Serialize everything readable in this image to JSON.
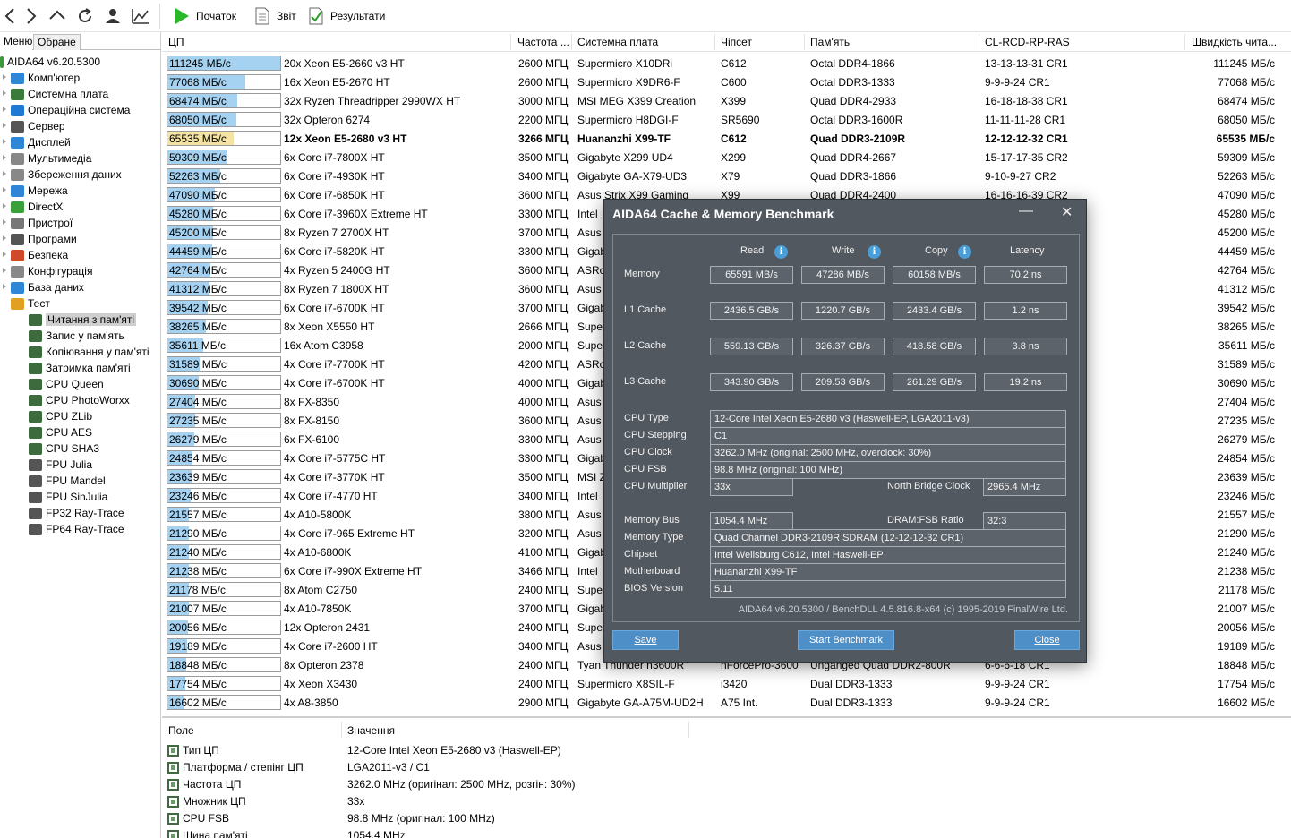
{
  "toolbar": {
    "start_label": "Початок",
    "report_label": "Звіт",
    "results_label": "Результати"
  },
  "left_panel": {
    "tab_menu": "Меню",
    "tab_favorites": "Обране",
    "tree": [
      {
        "label": "AIDA64 v6.20.5300",
        "icon": "aida64-icon",
        "color": "#3a9a3a"
      },
      {
        "label": "Комп'ютер",
        "icon": "computer-icon",
        "color": "#2f86d6"
      },
      {
        "label": "Системна плата",
        "icon": "motherboard-icon",
        "color": "#3a7a3a"
      },
      {
        "label": "Операційна система",
        "icon": "windows-icon",
        "color": "#1e78d4"
      },
      {
        "label": "Сервер",
        "icon": "server-icon",
        "color": "#555555"
      },
      {
        "label": "Дисплей",
        "icon": "display-icon",
        "color": "#2f86d6"
      },
      {
        "label": "Мультимедіа",
        "icon": "multimedia-icon",
        "color": "#888888"
      },
      {
        "label": "Збереження даних",
        "icon": "storage-icon",
        "color": "#888888"
      },
      {
        "label": "Мережа",
        "icon": "network-icon",
        "color": "#2f86d6"
      },
      {
        "label": "DirectX",
        "icon": "directx-icon",
        "color": "#3aa03a"
      },
      {
        "label": "Пристрої",
        "icon": "devices-icon",
        "color": "#777777"
      },
      {
        "label": "Програми",
        "icon": "programs-icon",
        "color": "#555555"
      },
      {
        "label": "Безпека",
        "icon": "security-icon",
        "color": "#d04a2a"
      },
      {
        "label": "Конфігурація",
        "icon": "config-icon",
        "color": "#888888"
      },
      {
        "label": "База даних",
        "icon": "database-icon",
        "color": "#2f86d6"
      },
      {
        "label": "Тест",
        "icon": "test-icon",
        "color": "#e0a020"
      },
      {
        "label": "Читання з пам'яті",
        "icon": "memory-read-icon",
        "color": "#3d6b3d"
      },
      {
        "label": "Запис у пам'ять",
        "icon": "memory-write-icon",
        "color": "#3d6b3d"
      },
      {
        "label": "Копіювання у пам'яті",
        "icon": "memory-copy-icon",
        "color": "#3d6b3d"
      },
      {
        "label": "Затримка пам'яті",
        "icon": "memory-latency-icon",
        "color": "#3d6b3d"
      },
      {
        "label": "CPU Queen",
        "icon": "cpu-queen-icon",
        "color": "#3d6b3d"
      },
      {
        "label": "CPU PhotoWorxx",
        "icon": "cpu-photoworxx-icon",
        "color": "#3d6b3d"
      },
      {
        "label": "CPU ZLib",
        "icon": "cpu-zlib-icon",
        "color": "#3d6b3d"
      },
      {
        "label": "CPU AES",
        "icon": "cpu-aes-icon",
        "color": "#3d6b3d"
      },
      {
        "label": "CPU SHA3",
        "icon": "cpu-sha3-icon",
        "color": "#3d6b3d"
      },
      {
        "label": "FPU Julia",
        "icon": "fpu-julia-icon",
        "color": "#555555"
      },
      {
        "label": "FPU Mandel",
        "icon": "fpu-mandel-icon",
        "color": "#555555"
      },
      {
        "label": "FPU SinJulia",
        "icon": "fpu-sinjulia-icon",
        "color": "#555555"
      },
      {
        "label": "FP32 Ray-Trace",
        "icon": "fp32-raytrace-icon",
        "color": "#555555"
      },
      {
        "label": "FP64 Ray-Trace",
        "icon": "fp64-raytrace-icon",
        "color": "#555555"
      }
    ]
  },
  "list": {
    "headers": [
      "ЦП",
      "Частота ...",
      "Системна плата",
      "Чіпсет",
      "Пам'ять",
      "CL-RCD-RP-RAS",
      "Швидкість чита..."
    ],
    "max_value": 111245,
    "rows": [
      {
        "bar": "111245 МБ/с",
        "value": 111245,
        "cpu": "20x Xeon E5-2660 v3 HT",
        "freq": "2600 МГЦ",
        "board": "Supermicro X10DRi",
        "chipset": "C612",
        "memory": "Octal DDR4-1866",
        "timings": "13-13-13-31 CR1",
        "speed": "111245 МБ/с"
      },
      {
        "bar": "77068 МБ/с",
        "value": 77068,
        "cpu": "16x Xeon E5-2670 HT",
        "freq": "2600 МГЦ",
        "board": "Supermicro X9DR6-F",
        "chipset": "C600",
        "memory": "Octal DDR3-1333",
        "timings": "9-9-9-24 CR1",
        "speed": "77068 МБ/с"
      },
      {
        "bar": "68474 МБ/с",
        "value": 68474,
        "cpu": "32x Ryzen Threadripper 2990WX HT",
        "freq": "3000 МГЦ",
        "board": "MSI MEG X399 Creation",
        "chipset": "X399",
        "memory": "Quad DDR4-2933",
        "timings": "16-18-18-38 CR1",
        "speed": "68474 МБ/с"
      },
      {
        "bar": "68050 МБ/с",
        "value": 68050,
        "cpu": "32x Opteron 6274",
        "freq": "2200 МГЦ",
        "board": "Supermicro H8DGI-F",
        "chipset": "SR5690",
        "memory": "Octal DDR3-1600R",
        "timings": "11-11-11-28 CR1",
        "speed": "68050 МБ/с"
      },
      {
        "bar": "65535 МБ/с",
        "value": 65535,
        "cpu": "12x Xeon E5-2680 v3 HT",
        "freq": "3266 МГЦ",
        "board": "Huananzhi X99-TF",
        "chipset": "C612",
        "memory": "Quad DDR3-2109R",
        "timings": "12-12-12-32 CR1",
        "speed": "65535 МБ/с",
        "highlight": true
      },
      {
        "bar": "59309 МБ/с",
        "value": 59309,
        "cpu": "6x Core i7-7800X HT",
        "freq": "3500 МГЦ",
        "board": "Gigabyte X299 UD4",
        "chipset": "X299",
        "memory": "Quad DDR4-2667",
        "timings": "15-17-17-35 CR2",
        "speed": "59309 МБ/с"
      },
      {
        "bar": "52263 МБ/с",
        "value": 52263,
        "cpu": "6x Core i7-4930K HT",
        "freq": "3400 МГЦ",
        "board": "Gigabyte GA-X79-UD3",
        "chipset": "X79",
        "memory": "Quad DDR3-1866",
        "timings": "9-10-9-27 CR2",
        "speed": "52263 МБ/с"
      },
      {
        "bar": "47090 МБ/с",
        "value": 47090,
        "cpu": "6x Core i7-6850K HT",
        "freq": "3600 МГЦ",
        "board": "Asus Strix X99 Gaming",
        "chipset": "X99",
        "memory": "Quad DDR4-2400",
        "timings": "16-16-16-39 CR2",
        "speed": "47090 МБ/с"
      },
      {
        "bar": "45280 МБ/с",
        "value": 45280,
        "cpu": "6x Core i7-3960X Extreme HT",
        "freq": "3300 МГЦ",
        "board": "Intel",
        "chipset": "",
        "memory": "",
        "timings": "",
        "speed": "45280 МБ/с"
      },
      {
        "bar": "45200 МБ/с",
        "value": 45200,
        "cpu": "8x Ryzen 7 2700X HT",
        "freq": "3700 МГЦ",
        "board": "Asus",
        "chipset": "",
        "memory": "",
        "timings": "",
        "speed": "45200 МБ/с"
      },
      {
        "bar": "44459 МБ/с",
        "value": 44459,
        "cpu": "6x Core i7-5820K HT",
        "freq": "3300 МГЦ",
        "board": "Gigab",
        "chipset": "",
        "memory": "",
        "timings": "",
        "speed": "44459 МБ/с"
      },
      {
        "bar": "42764 МБ/с",
        "value": 42764,
        "cpu": "4x Ryzen 5 2400G HT",
        "freq": "3600 МГЦ",
        "board": "ASRo",
        "chipset": "",
        "memory": "",
        "timings": "",
        "speed": "42764 МБ/с"
      },
      {
        "bar": "41312 МБ/с",
        "value": 41312,
        "cpu": "8x Ryzen 7 1800X HT",
        "freq": "3600 МГЦ",
        "board": "Asus",
        "chipset": "",
        "memory": "",
        "timings": "",
        "speed": "41312 МБ/с"
      },
      {
        "bar": "39542 МБ/с",
        "value": 39542,
        "cpu": "6x Core i7-6700K HT",
        "freq": "3700 МГЦ",
        "board": "Gigab",
        "chipset": "",
        "memory": "",
        "timings": "",
        "speed": "39542 МБ/с"
      },
      {
        "bar": "38265 МБ/с",
        "value": 38265,
        "cpu": "8x Xeon X5550 HT",
        "freq": "2666 МГЦ",
        "board": "Super",
        "chipset": "",
        "memory": "",
        "timings": "",
        "speed": "38265 МБ/с"
      },
      {
        "bar": "35611 МБ/с",
        "value": 35611,
        "cpu": "16x Atom C3958",
        "freq": "2000 МГЦ",
        "board": "Super",
        "chipset": "",
        "memory": "",
        "timings": "",
        "speed": "35611 МБ/с"
      },
      {
        "bar": "31589 МБ/с",
        "value": 31589,
        "cpu": "4x Core i7-7700K HT",
        "freq": "4200 МГЦ",
        "board": "ASRo",
        "chipset": "",
        "memory": "",
        "timings": "",
        "speed": "31589 МБ/с"
      },
      {
        "bar": "30690 МБ/с",
        "value": 30690,
        "cpu": "4x Core i7-6700K HT",
        "freq": "4000 МГЦ",
        "board": "Gigab",
        "chipset": "",
        "memory": "",
        "timings": "",
        "speed": "30690 МБ/с"
      },
      {
        "bar": "27404 МБ/с",
        "value": 27404,
        "cpu": "8x FX-8350",
        "freq": "4000 МГЦ",
        "board": "Asus",
        "chipset": "",
        "memory": "",
        "timings": "",
        "speed": "27404 МБ/с"
      },
      {
        "bar": "27235 МБ/с",
        "value": 27235,
        "cpu": "8x FX-8150",
        "freq": "3600 МГЦ",
        "board": "Asus",
        "chipset": "",
        "memory": "",
        "timings": "",
        "speed": "27235 МБ/с"
      },
      {
        "bar": "26279 МБ/с",
        "value": 26279,
        "cpu": "6x FX-6100",
        "freq": "3300 МГЦ",
        "board": "Asus",
        "chipset": "",
        "memory": "",
        "timings": "",
        "speed": "26279 МБ/с"
      },
      {
        "bar": "24854 МБ/с",
        "value": 24854,
        "cpu": "4x Core i7-5775C HT",
        "freq": "3300 МГЦ",
        "board": "Gigab",
        "chipset": "",
        "memory": "",
        "timings": "",
        "speed": "24854 МБ/с"
      },
      {
        "bar": "23639 МБ/с",
        "value": 23639,
        "cpu": "4x Core i7-3770K HT",
        "freq": "3500 МГЦ",
        "board": "MSI Z",
        "chipset": "",
        "memory": "",
        "timings": "",
        "speed": "23639 МБ/с"
      },
      {
        "bar": "23246 МБ/с",
        "value": 23246,
        "cpu": "4x Core i7-4770 HT",
        "freq": "3400 МГЦ",
        "board": "Intel",
        "chipset": "",
        "memory": "",
        "timings": "",
        "speed": "23246 МБ/с"
      },
      {
        "bar": "21557 МБ/с",
        "value": 21557,
        "cpu": "4x A10-5800K",
        "freq": "3800 МГЦ",
        "board": "Asus",
        "chipset": "",
        "memory": "",
        "timings": "",
        "speed": "21557 МБ/с"
      },
      {
        "bar": "21290 МБ/с",
        "value": 21290,
        "cpu": "4x Core i7-965 Extreme HT",
        "freq": "3200 МГЦ",
        "board": "Asus",
        "chipset": "",
        "memory": "",
        "timings": "",
        "speed": "21290 МБ/с"
      },
      {
        "bar": "21240 МБ/с",
        "value": 21240,
        "cpu": "4x A10-6800K",
        "freq": "4100 МГЦ",
        "board": "Gigab",
        "chipset": "",
        "memory": "",
        "timings": "",
        "speed": "21240 МБ/с"
      },
      {
        "bar": "21238 МБ/с",
        "value": 21238,
        "cpu": "6x Core i7-990X Extreme HT",
        "freq": "3466 МГЦ",
        "board": "Intel",
        "chipset": "",
        "memory": "",
        "timings": "",
        "speed": "21238 МБ/с"
      },
      {
        "bar": "21178 МБ/с",
        "value": 21178,
        "cpu": "8x Atom C2750",
        "freq": "2400 МГЦ",
        "board": "Super",
        "chipset": "",
        "memory": "",
        "timings": "",
        "speed": "21178 МБ/с"
      },
      {
        "bar": "21007 МБ/с",
        "value": 21007,
        "cpu": "4x A10-7850K",
        "freq": "3700 МГЦ",
        "board": "Gigab",
        "chipset": "",
        "memory": "",
        "timings": "",
        "speed": "21007 МБ/с"
      },
      {
        "bar": "20056 МБ/с",
        "value": 20056,
        "cpu": "12x Opteron 2431",
        "freq": "2400 МГЦ",
        "board": "Super",
        "chipset": "",
        "memory": "",
        "timings": "",
        "speed": "20056 МБ/с"
      },
      {
        "bar": "19189 МБ/с",
        "value": 19189,
        "cpu": "4x Core i7-2600 HT",
        "freq": "3400 МГЦ",
        "board": "Asus",
        "chipset": "",
        "memory": "",
        "timings": "",
        "speed": "19189 МБ/с"
      },
      {
        "bar": "18848 МБ/с",
        "value": 18848,
        "cpu": "8x Opteron 2378",
        "freq": "2400 МГЦ",
        "board": "Tyan Thunder n3600R",
        "chipset": "nForcePro-3600",
        "memory": "Unganged Quad DDR2-800R",
        "timings": "6-6-6-18 CR1",
        "speed": "18848 МБ/с"
      },
      {
        "bar": "17754 МБ/с",
        "value": 17754,
        "cpu": "4x Xeon X3430",
        "freq": "2400 МГЦ",
        "board": "Supermicro X8SIL-F",
        "chipset": "i3420",
        "memory": "Dual DDR3-1333",
        "timings": "9-9-9-24 CR1",
        "speed": "17754 МБ/с"
      },
      {
        "bar": "16602 МБ/с",
        "value": 16602,
        "cpu": "4x A8-3850",
        "freq": "2900 МГЦ",
        "board": "Gigabyte GA-A75M-UD2H",
        "chipset": "A75 Int.",
        "memory": "Dual DDR3-1333",
        "timings": "9-9-9-24 CR1",
        "speed": "16602 МБ/с"
      }
    ]
  },
  "bottom_panel": {
    "col_field": "Поле",
    "col_value": "Значення",
    "rows": [
      {
        "field": "Тип ЦП",
        "value": "12-Core Intel Xeon E5-2680 v3  (Haswell-EP)"
      },
      {
        "field": "Платформа / степінг ЦП",
        "value": "LGA2011-v3 / C1"
      },
      {
        "field": "Частота ЦП",
        "value": "3262.0 MHz  (оригінал:  2500 MHz, розгін:  30%)"
      },
      {
        "field": "Множник ЦП",
        "value": "33x"
      },
      {
        "field": "CPU FSB",
        "value": "98.8 MHz  (оригінал:  100 MHz)"
      },
      {
        "field": "Шина пам'яті",
        "value": "1054.4 MHz"
      }
    ]
  },
  "dialog": {
    "title": "AIDA64 Cache & Memory Benchmark",
    "minimize": "—",
    "close": "✕",
    "col_read": "Read",
    "col_write": "Write",
    "col_copy": "Copy",
    "col_latency": "Latency",
    "results": [
      {
        "label": "Memory",
        "read": "65591 MB/s",
        "write": "47286 MB/s",
        "copy": "60158 MB/s",
        "latency": "70.2 ns"
      },
      {
        "label": "L1 Cache",
        "read": "2436.5 GB/s",
        "write": "1220.7 GB/s",
        "copy": "2433.4 GB/s",
        "latency": "1.2 ns"
      },
      {
        "label": "L2 Cache",
        "read": "559.13 GB/s",
        "write": "326.37 GB/s",
        "copy": "418.58 GB/s",
        "latency": "3.8 ns"
      },
      {
        "label": "L3 Cache",
        "read": "343.90 GB/s",
        "write": "209.53 GB/s",
        "copy": "261.29 GB/s",
        "latency": "19.2 ns"
      }
    ],
    "cpu_type_label": "CPU Type",
    "cpu_type": "12-Core Intel Xeon E5-2680 v3  (Haswell-EP, LGA2011-v3)",
    "cpu_stepping_label": "CPU Stepping",
    "cpu_stepping": "C1",
    "cpu_clock_label": "CPU Clock",
    "cpu_clock": "3262.0 MHz  (original: 2500 MHz, overclock: 30%)",
    "cpu_fsb_label": "CPU FSB",
    "cpu_fsb": "98.8 MHz  (original: 100 MHz)",
    "cpu_mult_label": "CPU Multiplier",
    "cpu_mult": "33x",
    "nb_clock_label": "North Bridge Clock",
    "nb_clock": "2965.4 MHz",
    "mem_bus_label": "Memory Bus",
    "mem_bus": "1054.4 MHz",
    "dram_fsb_label": "DRAM:FSB Ratio",
    "dram_fsb": "32:3",
    "mem_type_label": "Memory Type",
    "mem_type": "Quad Channel DDR3-2109R SDRAM  (12-12-12-32 CR1)",
    "chipset_label": "Chipset",
    "chipset": "Intel Wellsburg C612, Intel Haswell-EP",
    "motherboard_label": "Motherboard",
    "motherboard": "Huananzhi X99-TF",
    "bios_label": "BIOS Version",
    "bios": "5.11",
    "copyright": "AIDA64 v6.20.5300 / BenchDLL 4.5.816.8-x64  (c) 1995-2019 FinalWire Ltd.",
    "save": "Save",
    "start": "Start Benchmark",
    "close_btn": "Close"
  }
}
